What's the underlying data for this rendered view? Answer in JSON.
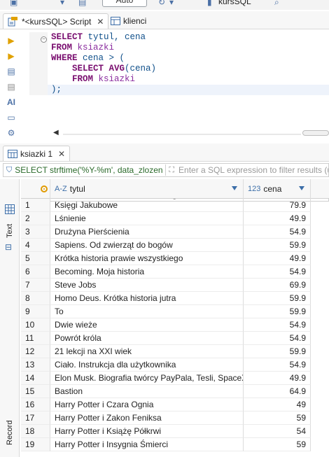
{
  "toolbar": {
    "transaction_mode": "Auto",
    "connection": "kursSQL"
  },
  "editor_tabs": [
    {
      "label": "*<kursSQL> Script",
      "icon": "sql-script-icon",
      "active": true
    },
    {
      "label": "klienci",
      "icon": "table-icon",
      "active": false
    }
  ],
  "editor": {
    "lines": [
      [
        {
          "t": "SELECT",
          "c": "kw"
        },
        {
          "t": " tytul, cena",
          "c": "id"
        }
      ],
      [
        {
          "t": "FROM",
          "c": "kw"
        },
        {
          "t": " ksiazki",
          "c": "tb"
        }
      ],
      [
        {
          "t": "WHERE",
          "c": "kw"
        },
        {
          "t": " cena > (",
          "c": "id"
        }
      ],
      [
        {
          "t": "    ",
          "c": "pn"
        },
        {
          "t": "SELECT",
          "c": "kw"
        },
        {
          "t": " AVG",
          "c": "kw"
        },
        {
          "t": "(cena)",
          "c": "id"
        }
      ],
      [
        {
          "t": "    ",
          "c": "pn"
        },
        {
          "t": "FROM",
          "c": "kw"
        },
        {
          "t": " ksiazki",
          "c": "tb"
        }
      ],
      [
        {
          "t": ");",
          "c": "id"
        }
      ]
    ],
    "side_tools": [
      "run-icon",
      "run-script-icon",
      "explain-icon",
      "notes-icon",
      "ai-icon",
      "terminal-icon",
      "settings-icon"
    ],
    "side_tool_labels": {
      "ai-icon": "AI"
    }
  },
  "results": {
    "tab_label": "ksiazki 1",
    "filter_query": "SELECT strftime('%Y-%m', data_zlozen",
    "filter_placeholder": "Enter a SQL expression to filter results (us",
    "side_tabs": {
      "grid": "Grid",
      "text": "Text",
      "record": "Record"
    },
    "columns": [
      {
        "name": "tytul",
        "type_icon": "A-Z"
      },
      {
        "name": "cena",
        "type_icon": "123"
      }
    ],
    "rows": [
      {
        "n": "1",
        "tytul": "Księgi Jakubowe",
        "cena": "79.9"
      },
      {
        "n": "2",
        "tytul": "Lśnienie",
        "cena": "49.9"
      },
      {
        "n": "3",
        "tytul": "Drużyna Pierścienia",
        "cena": "54.9"
      },
      {
        "n": "4",
        "tytul": "Sapiens. Od zwierząt do bogów",
        "cena": "59.9"
      },
      {
        "n": "5",
        "tytul": "Krótka historia prawie wszystkiego",
        "cena": "49.9"
      },
      {
        "n": "6",
        "tytul": "Becoming. Moja historia",
        "cena": "54.9"
      },
      {
        "n": "7",
        "tytul": "Steve Jobs",
        "cena": "69.9"
      },
      {
        "n": "8",
        "tytul": "Homo Deus. Krótka historia jutra",
        "cena": "59.9"
      },
      {
        "n": "9",
        "tytul": "To",
        "cena": "59.9"
      },
      {
        "n": "10",
        "tytul": "Dwie wieże",
        "cena": "54.9"
      },
      {
        "n": "11",
        "tytul": "Powrót króla",
        "cena": "54.9"
      },
      {
        "n": "12",
        "tytul": "21 lekcji na XXI wiek",
        "cena": "59.9"
      },
      {
        "n": "13",
        "tytul": "Ciało. Instrukcja dla użytkownika",
        "cena": "54.9"
      },
      {
        "n": "14",
        "tytul": "Elon Musk. Biografia twórcy PayPala, Tesli, SpaceX",
        "cena": "49.9"
      },
      {
        "n": "15",
        "tytul": "Bastion",
        "cena": "64.9"
      },
      {
        "n": "16",
        "tytul": "Harry Potter i Czara Ognia",
        "cena": "49"
      },
      {
        "n": "17",
        "tytul": "Harry Potter i Zakon Feniksa",
        "cena": "59"
      },
      {
        "n": "18",
        "tytul": "Harry Potter i Książę Półkrwi",
        "cena": "54"
      },
      {
        "n": "19",
        "tytul": "Harry Potter i Insygnia Śmierci",
        "cena": "59"
      }
    ]
  },
  "colors": {
    "keyword": "#7a0f70",
    "table": "#8a2c9e",
    "identifier": "#0f4f8a",
    "accent": "#3c6ea8",
    "filter_text": "#2b6a2b"
  }
}
